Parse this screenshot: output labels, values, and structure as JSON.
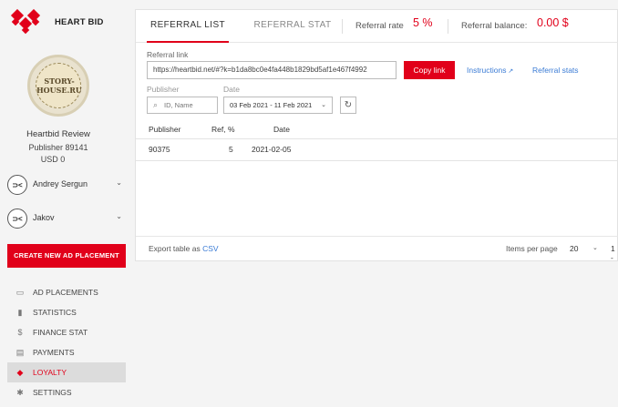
{
  "brand": {
    "name": "HEART BID",
    "color": "#e1001a"
  },
  "profile": {
    "avatar_text": "STORY-HOUSE.RU",
    "name": "Heartbid Review",
    "publisher": "Publisher 89141",
    "balance": "USD 0"
  },
  "accounts": [
    {
      "name": "Andrey Sergun",
      "badge": "⊃<"
    },
    {
      "name": "Jakov",
      "badge": "⊃<"
    }
  ],
  "create_button": "CREATE NEW AD PLACEMENT",
  "nav": [
    {
      "label": "AD PLACEMENTS",
      "icon": "ad-placements-icon",
      "glyph": "▭"
    },
    {
      "label": "STATISTICS",
      "icon": "bar-chart-icon",
      "glyph": "▮"
    },
    {
      "label": "FINANCE STAT",
      "icon": "dollar-icon",
      "glyph": "$"
    },
    {
      "label": "PAYMENTS",
      "icon": "payments-icon",
      "glyph": "▤"
    },
    {
      "label": "LOYALTY",
      "icon": "tag-icon",
      "glyph": "◆",
      "active": true
    },
    {
      "label": "SETTINGS",
      "icon": "gear-icon",
      "glyph": "✱"
    }
  ],
  "tabs": [
    {
      "label": "REFERRAL LIST",
      "active": true
    },
    {
      "label": "REFERRAL STAT",
      "active": false
    }
  ],
  "stats": {
    "rate_label": "Referral rate",
    "rate_value": "5 %",
    "balance_label": "Referral balance:",
    "balance_value": "0.00 $"
  },
  "referral": {
    "label": "Referral link",
    "value": "https://heartbid.net/#?k=b1da8bc0e4fa448b1829bd5af1e467f4992",
    "copy_label": "Copy link",
    "instructions_label": "Instructions",
    "stats_label": "Referral stats"
  },
  "filters": {
    "publisher_label": "Publisher",
    "publisher_placeholder": "ID, Name",
    "date_label": "Date",
    "date_value": "03 Feb 2021 - 11 Feb 2021"
  },
  "table": {
    "headers": [
      "Publisher",
      "Ref, %",
      "Date"
    ],
    "rows": [
      [
        "90375",
        "5",
        "2021-02-05"
      ]
    ]
  },
  "footer": {
    "export_label": "Export table as",
    "export_format": "CSV",
    "ipp_label": "Items per page",
    "ipp_value": "20",
    "range": "1 -"
  }
}
